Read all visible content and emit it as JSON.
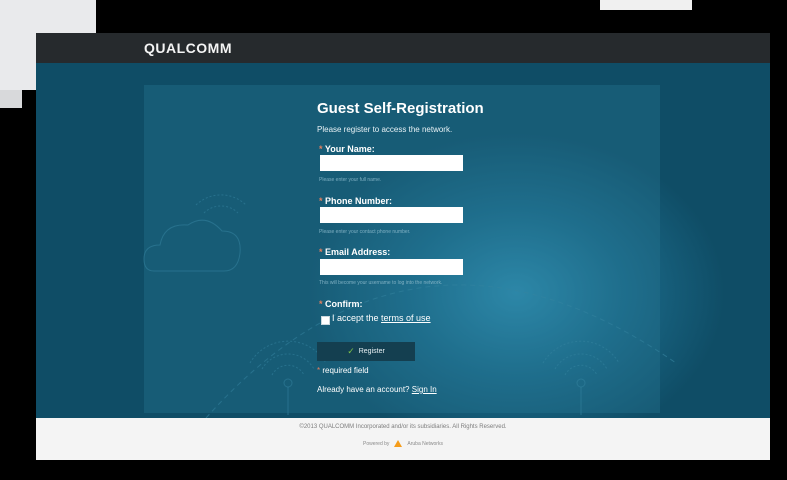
{
  "header": {
    "logo_text": "QUALCOMM"
  },
  "form": {
    "title": "Guest Self-Registration",
    "subtitle": "Please register to access the network.",
    "required_marker": "*",
    "fields": [
      {
        "label": "Your Name:",
        "value": "",
        "hint": "Please enter your full name."
      },
      {
        "label": "Phone Number:",
        "value": "",
        "hint": "Please enter your contact phone number."
      },
      {
        "label": "Email Address:",
        "value": "",
        "hint": "This will become your username to log into the network."
      }
    ],
    "confirm_label": "Confirm:",
    "accept_text": "I accept the",
    "terms_link": "terms of use",
    "register_label": "Register",
    "required_note": "required field",
    "account_text": "Already have an account?",
    "sign_in_link": "Sign In"
  },
  "footer": {
    "copyright": "©2013 QUALCOMM Incorporated and/or its subsidiaries. All Rights Reserved.",
    "powered_by": "Powered by",
    "vendor": "Aruba Networks"
  },
  "colors": {
    "topbar": "#262a2d",
    "background": "#0e4d66",
    "accent_required": "#e57f5f",
    "register_button": "#143f50",
    "check": "#7cc24a"
  }
}
